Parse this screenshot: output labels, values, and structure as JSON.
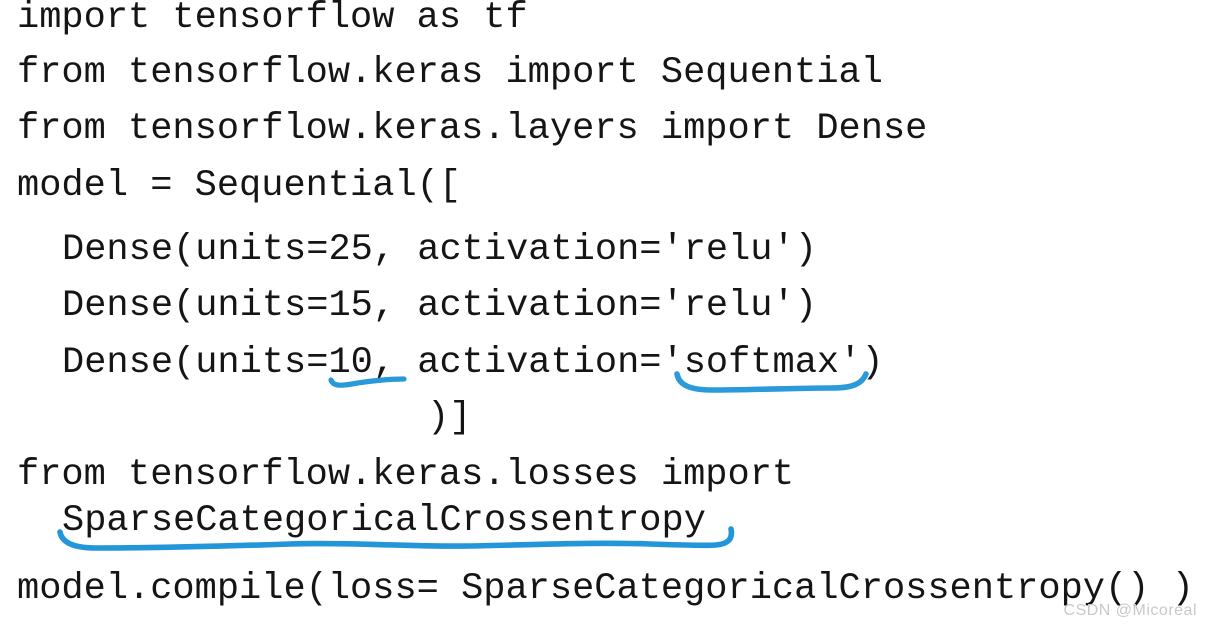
{
  "page": {
    "background_color": "#ffffff",
    "text_color": "#151515",
    "annotation_color": "#1f93d8"
  },
  "code": {
    "language": "python",
    "lines": [
      "import tensorflow as tf",
      "from tensorflow.keras import Sequential",
      "from tensorflow.keras.layers import Dense",
      "model = Sequential([",
      "Dense(units=25, activation='relu')",
      "Dense(units=15, activation='relu')",
      "Dense(units=10, activation='softmax')",
      ")]",
      "from tensorflow.keras.losses import",
      "SparseCategoricalCrossentropy",
      "model.compile(loss= SparseCategoricalCrossentropy() )"
    ]
  },
  "annotations": [
    {
      "name": "underline-units-10",
      "target_text": "10,",
      "style": "straight-hooked-underline",
      "color": "#1f93d8"
    },
    {
      "name": "underline-softmax",
      "target_text": "'softmax'",
      "style": "curved-bracket-underline",
      "color": "#2196d9"
    },
    {
      "name": "underline-sparse-categorical-crossentropy",
      "target_text": "SparseCategoricalCrossentropy",
      "style": "long-wavy-hooked-underline",
      "color": "#1a92d8"
    }
  ],
  "watermark": {
    "text": "CSDN @Micoreal",
    "color": "#c9c9c9"
  }
}
